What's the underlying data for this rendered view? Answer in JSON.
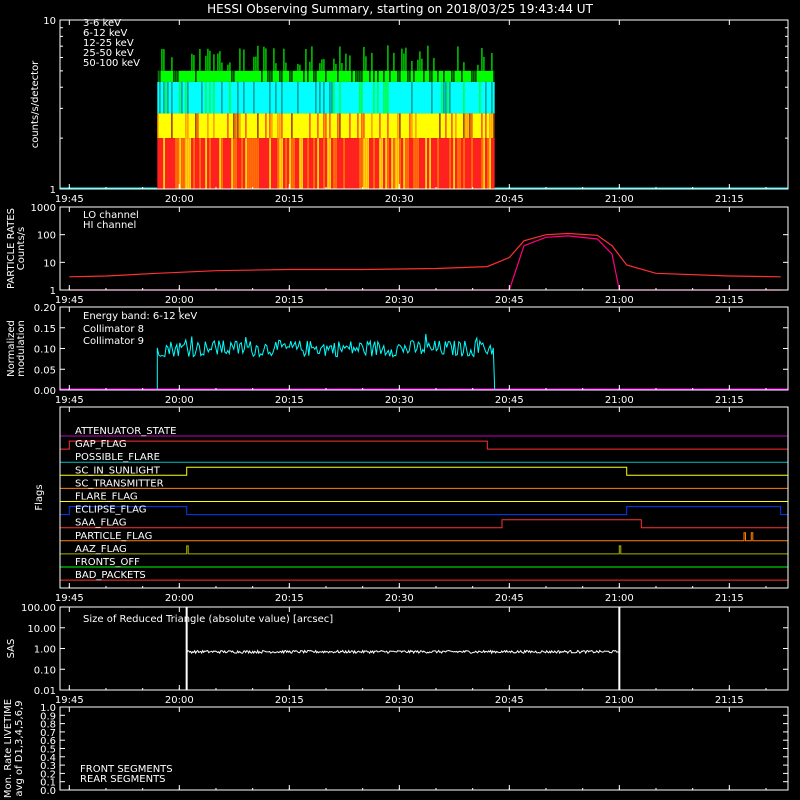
{
  "title": "HESSI Observing Summary, starting on 2018/03/25 19:43:44 UT",
  "time_ticks": [
    "19:45",
    "20:00",
    "20:15",
    "20:30",
    "20:45",
    "21:00",
    "21:15"
  ],
  "colors": {
    "background": "#000000",
    "axis": "#ffffff",
    "e3_6": "#ff2020",
    "e6_12": "#ff8000",
    "e12_25": "#ffff00",
    "e25_50": "#00ff00",
    "e50_100": "#00ffff",
    "lo": "#ff3030",
    "hi": "#ff0080",
    "coll8": "#00ffff",
    "coll9": "#ff00ff",
    "front": "#00ff00",
    "rear": "#008000"
  },
  "chart_data": [
    {
      "type": "bar",
      "ylabel": "counts/s/detector",
      "yscale": "log",
      "ylim": [
        1,
        10
      ],
      "yticks": [
        "10",
        "1"
      ],
      "series": [
        {
          "name": "3-6 keV",
          "color": "#ff2020"
        },
        {
          "name": "6-12 keV",
          "color": "#ff8000"
        },
        {
          "name": "12-25 keV",
          "color": "#ffff00"
        },
        {
          "name": "25-50 keV",
          "color": "#00ff00"
        },
        {
          "name": "50-100 keV",
          "color": "#00ffff"
        }
      ],
      "data_interval": [
        "19:57",
        "20:43"
      ],
      "approx_levels": {
        "3-6 keV": 2.0,
        "6-12 keV": 2.0,
        "12-25 keV": 2.8,
        "25-50 keV": 5.0,
        "50-100 keV": 4.3
      }
    },
    {
      "type": "line",
      "ylabel": "PARTICLE RATES Counts/s",
      "yscale": "log",
      "ylim": [
        1,
        1000
      ],
      "yticks": [
        "1000",
        "100",
        "10",
        "1"
      ],
      "series": [
        {
          "name": "LO channel",
          "color": "#ff3030",
          "points": [
            [
              "19:45",
              3
            ],
            [
              "19:50",
              3.2
            ],
            [
              "19:57",
              4
            ],
            [
              "20:05",
              5
            ],
            [
              "20:15",
              5.5
            ],
            [
              "20:25",
              5.5
            ],
            [
              "20:35",
              6
            ],
            [
              "20:42",
              7
            ],
            [
              "20:45",
              15
            ],
            [
              "20:47",
              60
            ],
            [
              "20:50",
              100
            ],
            [
              "20:53",
              110
            ],
            [
              "20:57",
              95
            ],
            [
              "20:59",
              40
            ],
            [
              "21:01",
              8
            ],
            [
              "21:05",
              4
            ],
            [
              "21:15",
              3.2
            ],
            [
              "21:22",
              3
            ]
          ]
        },
        {
          "name": "HI channel",
          "color": "#ff0080",
          "points": [
            [
              "19:45",
              1
            ],
            [
              "20:45",
              1
            ],
            [
              "20:47",
              40
            ],
            [
              "20:50",
              80
            ],
            [
              "20:53",
              90
            ],
            [
              "20:57",
              70
            ],
            [
              "20:59",
              20
            ],
            [
              "21:00",
              1
            ],
            [
              "21:22",
              1
            ]
          ]
        }
      ]
    },
    {
      "type": "line",
      "ylabel": "Normalized modulation",
      "ylim": [
        0,
        0.2
      ],
      "yticks": [
        "0.20",
        "0.15",
        "0.10",
        "0.05",
        "0.00"
      ],
      "legend_header": "Energy band: 6-12 keV",
      "series": [
        {
          "name": "Collimator 8",
          "color": "#00ffff",
          "active_interval": [
            "19:57",
            "20:43"
          ],
          "approx_mean": 0.1
        },
        {
          "name": "Collimator 9",
          "color": "#ff00ff",
          "approx_mean": 0
        }
      ]
    },
    {
      "type": "line",
      "ylabel": "Flags",
      "series": [
        {
          "name": "ATTENUATOR_STATE",
          "color": "#c000c0",
          "high_intervals": []
        },
        {
          "name": "GAP_FLAG",
          "color": "#ff3030",
          "high_intervals": [
            [
              "19:45",
              "20:42"
            ]
          ]
        },
        {
          "name": "POSSIBLE_FLARE",
          "color": "#00c0c0",
          "high_intervals": []
        },
        {
          "name": "SC_IN_SUNLIGHT",
          "color": "#ffff00",
          "high_intervals": [
            [
              "20:01",
              "21:01"
            ]
          ]
        },
        {
          "name": "SC_TRANSMITTER",
          "color": "#ff8000",
          "high_intervals": []
        },
        {
          "name": "FLARE_FLAG",
          "color": "#ffff00",
          "high_intervals": []
        },
        {
          "name": "ECLIPSE_FLAG",
          "color": "#0040ff",
          "high_intervals": [
            [
              "19:45",
              "20:01"
            ],
            [
              "21:01",
              "21:22"
            ]
          ]
        },
        {
          "name": "SAA_FLAG",
          "color": "#ff3030",
          "high_intervals": [
            [
              "20:44",
              "21:03"
            ]
          ]
        },
        {
          "name": "PARTICLE_FLAG",
          "color": "#ff8000",
          "high_intervals": [
            [
              "21:17",
              "21:17"
            ],
            [
              "21:18",
              "21:18"
            ]
          ]
        },
        {
          "name": "AAZ_FLAG",
          "color": "#b0b000",
          "high_intervals": [
            [
              "20:01",
              "20:01"
            ],
            [
              "21:00",
              "21:00"
            ]
          ]
        },
        {
          "name": "FRONTS_OFF",
          "color": "#00ff00",
          "high_intervals": []
        },
        {
          "name": "BAD_PACKETS",
          "color": "#ff3030",
          "high_intervals": []
        }
      ]
    },
    {
      "type": "line",
      "ylabel": "SAS",
      "yscale": "log",
      "ylim": [
        0.01,
        100
      ],
      "yticks": [
        "100.00",
        "10.00",
        "1.00",
        "0.10",
        "0.01"
      ],
      "annotation": "Size of Reduced Triangle (absolute value) [arcsec]",
      "series": [
        {
          "color": "#ffffff",
          "active_interval": [
            "20:01",
            "21:00"
          ],
          "approx_level": 0.7
        }
      ]
    },
    {
      "type": "line",
      "ylabel": "Mon. Rate LIVETIME avg of D1,3,4,5,6,9",
      "ylim": [
        0,
        1
      ],
      "yticks": [
        "1.0",
        "0.9",
        "0.8",
        "0.7",
        "0.6",
        "0.5",
        "0.4",
        "0.3",
        "0.2",
        "0.1",
        "0.0"
      ],
      "series": [
        {
          "name": "FRONT SEGMENTS",
          "color": "#00ff00"
        },
        {
          "name": "REAR SEGMENTS",
          "color": "#008000"
        }
      ]
    }
  ]
}
